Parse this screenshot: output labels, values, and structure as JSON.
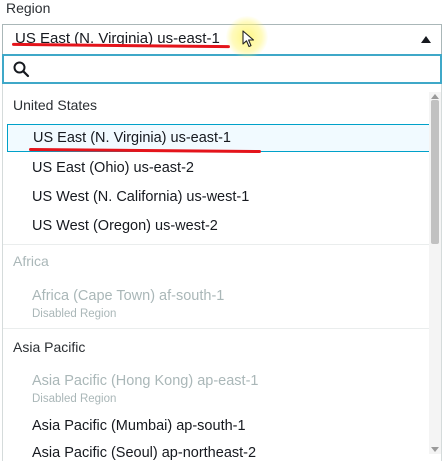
{
  "field": {
    "label": "Region",
    "selected_value": "US East (N. Virginia) us-east-1"
  },
  "search": {
    "value": "",
    "placeholder": ""
  },
  "groups": [
    {
      "name": "United States",
      "disabled": false,
      "options": [
        {
          "label": "US East (N. Virginia) us-east-1",
          "selected": true
        },
        {
          "label": "US East (Ohio) us-east-2"
        },
        {
          "label": "US West (N. California) us-west-1"
        },
        {
          "label": "US West (Oregon) us-west-2"
        }
      ]
    },
    {
      "name": "Africa",
      "disabled": true,
      "options": [
        {
          "label": "Africa (Cape Town) af-south-1",
          "sub": "Disabled Region",
          "disabled": true
        }
      ]
    },
    {
      "name": "Asia Pacific",
      "disabled": false,
      "options": [
        {
          "label": "Asia Pacific (Hong Kong) ap-east-1",
          "sub": "Disabled Region",
          "disabled": true
        },
        {
          "label": "Asia Pacific (Mumbai) ap-south-1"
        },
        {
          "label": "Asia Pacific (Seoul) ap-northeast-2"
        }
      ]
    }
  ],
  "colors": {
    "selected_border": "#00a1c9",
    "selected_bg": "#f1faff",
    "search_focus": "#3fa8c8",
    "annotation_red": "#e4141b",
    "disabled_text": "#aab7b8"
  },
  "icons": {
    "dropdown": "caret-up-icon",
    "search": "search-icon",
    "cursor": "mouse-cursor-icon"
  }
}
